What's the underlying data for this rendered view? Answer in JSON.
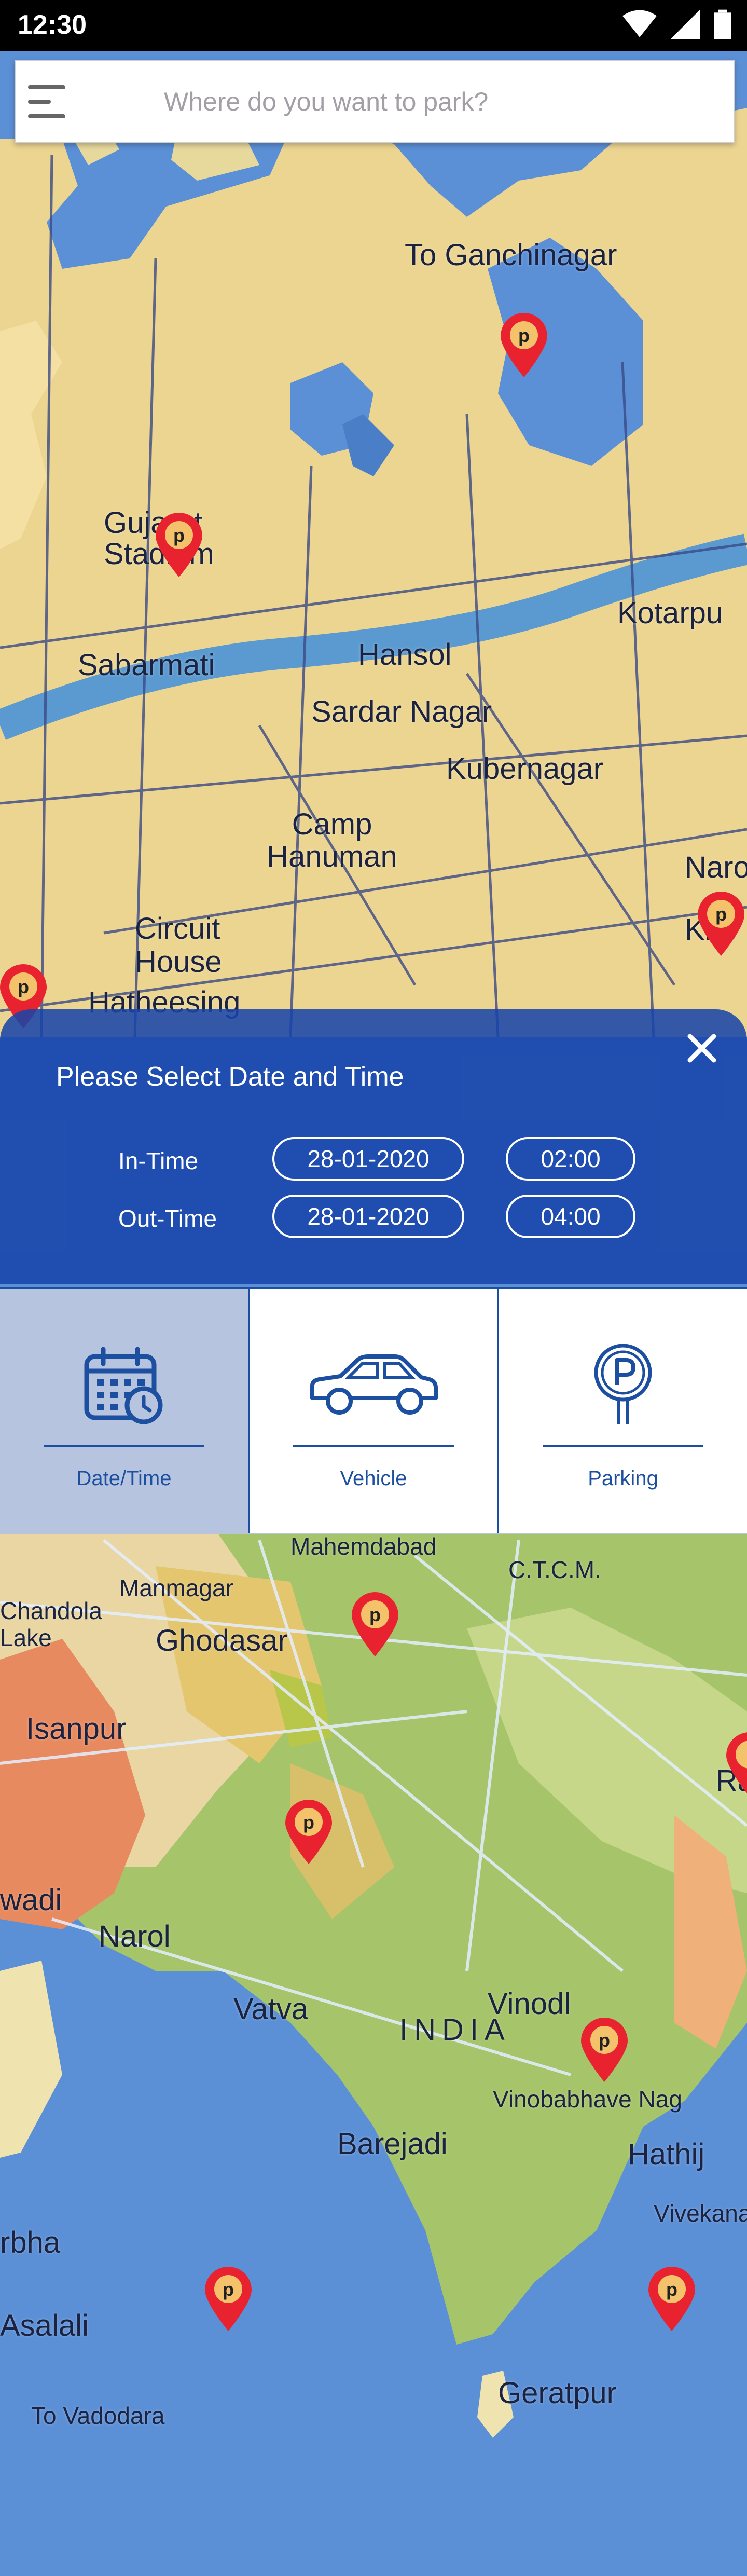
{
  "status_bar": {
    "time": "12:30"
  },
  "search": {
    "placeholder": "Where do you want to park?"
  },
  "map": {
    "labels": [
      "To Ganchinagar",
      "Gujarat Stadium",
      "Sabarmati",
      "Hansol",
      "Sardar Nagar",
      "Kubernagar",
      "Kotarpu",
      "Camp Hanuman",
      "Circuit House",
      "Naroda",
      "Kris",
      "Hatheesing",
      "Mahemdabad",
      "C.T.C.M.",
      "Manmagar",
      "Chandola Lake",
      "Ghodasar",
      "Isanpur",
      "Narol",
      "Vatva",
      "INDIA",
      "Vinodl",
      "Vinobabhave Nag",
      "Barejadi",
      "Hathij",
      "Vivekanand",
      "Asalali",
      "To Vadodara",
      "Geratpur",
      "rbha",
      "wadi",
      "Ra"
    ]
  },
  "datetime_panel": {
    "title": "Please Select Date and Time",
    "in_time_label": "In-Time",
    "in_date": "28-01-2020",
    "in_time": "02:00",
    "out_time_label": "Out-Time",
    "out_date": "28-01-2020",
    "out_time": "04:00"
  },
  "tabs": [
    {
      "label": "Date/Time",
      "icon": "calendar-clock-icon",
      "active": true
    },
    {
      "label": "Vehicle",
      "icon": "car-icon",
      "active": false
    },
    {
      "label": "Parking",
      "icon": "parking-sign-icon",
      "active": false
    }
  ],
  "colors": {
    "panel": "#1644aa",
    "accent": "#1d4fa0",
    "active_tab": "#b6c4e0",
    "pin": "#e8232f"
  }
}
